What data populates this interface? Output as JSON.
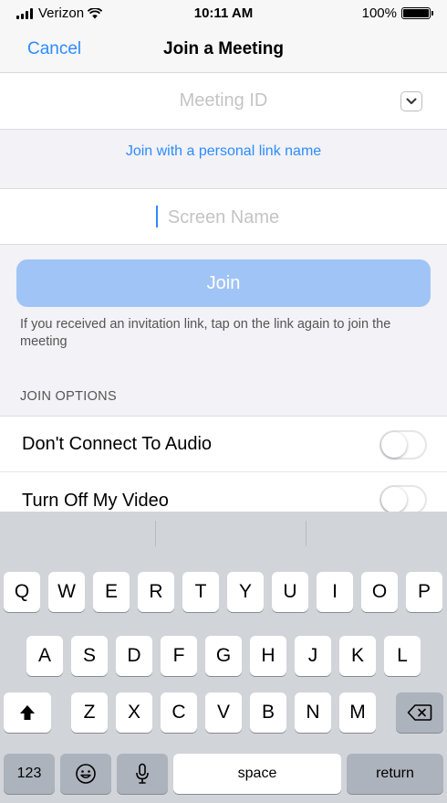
{
  "status_bar": {
    "carrier": "Verizon",
    "time": "10:11 AM",
    "battery": "100%",
    "battery_level": 1.0
  },
  "nav": {
    "cancel_label": "Cancel",
    "title": "Join a Meeting"
  },
  "meeting_id": {
    "placeholder": "Meeting ID"
  },
  "personal_link": "Join with a personal link name",
  "screen_name": {
    "placeholder": "Screen Name"
  },
  "join_label": "Join",
  "hint": "If you received an invitation link, tap on the link again to join the meeting",
  "join_options": {
    "header": "JOIN OPTIONS",
    "items": [
      {
        "label": "Don't Connect To Audio",
        "enabled": false
      },
      {
        "label": "Turn Off My Video",
        "enabled": false
      }
    ]
  },
  "keyboard": {
    "row1": [
      "Q",
      "W",
      "E",
      "R",
      "T",
      "Y",
      "U",
      "I",
      "O",
      "P"
    ],
    "row2": [
      "A",
      "S",
      "D",
      "F",
      "G",
      "H",
      "J",
      "K",
      "L"
    ],
    "row3": [
      "Z",
      "X",
      "C",
      "V",
      "B",
      "N",
      "M"
    ],
    "numbers_label": "123",
    "space_label": "space",
    "return_label": "return"
  },
  "colors": {
    "accent": "#2d8cff",
    "join_button": "#a1c4f6",
    "keyboard_bg": "#d1d4d9"
  }
}
